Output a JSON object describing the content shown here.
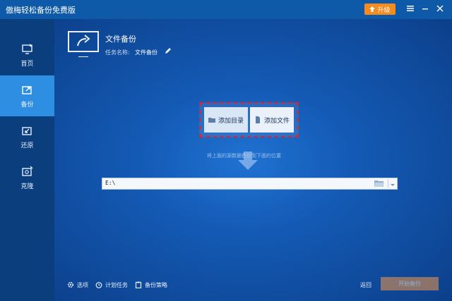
{
  "app": {
    "title": "傲梅轻松备份免费版"
  },
  "toolbar": {
    "upgrade_label": "升级"
  },
  "sidebar": {
    "items": [
      {
        "label": "首页"
      },
      {
        "label": "备份"
      },
      {
        "label": "还原"
      },
      {
        "label": "克隆"
      }
    ]
  },
  "header": {
    "title": "文件备份",
    "task_name_label": "任务名称:",
    "task_name_value": "文件备份"
  },
  "source": {
    "add_directory_label": "添加目录",
    "add_file_label": "添加文件"
  },
  "hint": "将上面的源数据备份到下面的位置",
  "destination": {
    "value": "E:\\"
  },
  "bottom": {
    "options_label": "选项",
    "schedule_label": "计划任务",
    "strategy_label": "备份策略",
    "back_label": "返回",
    "start_label": "开始备份"
  },
  "colors": {
    "accent_orange": "#f58a1f",
    "active_blue": "#2e8fe2",
    "highlight_red": "#e0232b"
  }
}
